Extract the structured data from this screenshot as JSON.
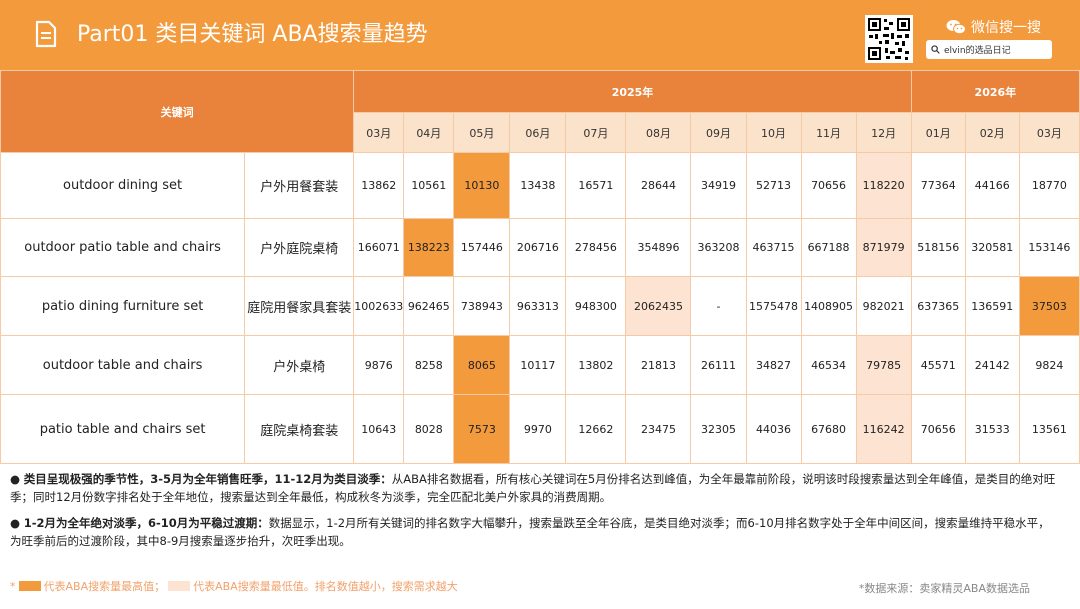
{
  "header": {
    "title": "Part01 类目关键词 ABA搜索量趋势",
    "brand_label": "微信搜一搜",
    "search_text": "elvin的选品日记"
  },
  "table": {
    "keyword_header": "关键词",
    "year_2025": "2025年",
    "year_2026": "2026年",
    "months": [
      "03月",
      "04月",
      "05月",
      "06月",
      "07月",
      "08月",
      "09月",
      "10月",
      "11月",
      "12月",
      "01月",
      "02月",
      "03月"
    ],
    "rows": [
      {
        "en": "outdoor dining set",
        "cn": "户外用餐套装",
        "values": [
          "13862",
          "10561",
          "10130",
          "13438",
          "16571",
          "28644",
          "34919",
          "52713",
          "70656",
          "118220",
          "77364",
          "44166",
          "18770"
        ],
        "hi": [
          2
        ],
        "lo": [
          9
        ]
      },
      {
        "en": "outdoor patio table and chairs",
        "cn": "户外庭院桌椅",
        "values": [
          "166071",
          "138223",
          "157446",
          "206716",
          "278456",
          "354896",
          "363208",
          "463715",
          "667188",
          "871979",
          "518156",
          "320581",
          "153146"
        ],
        "hi": [
          1
        ],
        "lo": [
          9
        ]
      },
      {
        "en": "patio dining furniture set",
        "cn": "庭院用餐家具套装",
        "values": [
          "1002633",
          "962465",
          "738943",
          "963313",
          "948300",
          "2062435",
          "-",
          "1575478",
          "1408905",
          "982021",
          "637365",
          "136591",
          "37503"
        ],
        "hi": [
          12
        ],
        "lo": [
          5
        ]
      },
      {
        "en": "outdoor table and chairs",
        "cn": "户外桌椅",
        "values": [
          "9876",
          "8258",
          "8065",
          "10117",
          "13802",
          "21813",
          "26111",
          "34827",
          "46534",
          "79785",
          "45571",
          "24142",
          "9824"
        ],
        "hi": [
          2
        ],
        "lo": [
          9
        ]
      },
      {
        "en": "patio table and chairs set",
        "cn": "庭院桌椅套装",
        "values": [
          "10643",
          "8028",
          "7573",
          "9970",
          "12662",
          "23475",
          "32305",
          "44036",
          "67680",
          "116242",
          "70656",
          "31533",
          "13561"
        ],
        "hi": [
          2
        ],
        "lo": [
          9
        ]
      }
    ]
  },
  "notes": [
    {
      "bold": "类目呈现极强的季节性，3-5月为全年销售旺季，11-12月为类目淡季：",
      "text": "从ABA排名数据看，所有核心关键词在5月份排名达到峰值，为全年最靠前阶段，说明该时段搜索量达到全年峰值，是类目的绝对旺季；同时12月份数字排名处于全年地位，搜索量达到全年最低，构成秋冬为淡季，完全匹配北美户外家具的消费周期。"
    },
    {
      "bold": "1-2月为全年绝对淡季，6-10月为平稳过渡期：",
      "text": "数据显示，1-2月所有关键词的排名数字大幅攀升，搜索量跌至全年谷底，是类目绝对淡季；而6-10月排名数字处于全年中间区间，搜索量维持平稳水平，为旺季前后的过渡阶段，其中8-9月搜索量逐步抬升，次旺季出现。"
    }
  ],
  "legend": {
    "prefix": "*",
    "high_label": "代表ABA搜索量最高值；",
    "low_label": "代表ABA搜索量最低值。排名数值越小，搜索需求越大",
    "high_color": "#f39a3c",
    "low_color": "#fde4d2"
  },
  "source": "*数据来源：卖家精灵ABA数据选品"
}
